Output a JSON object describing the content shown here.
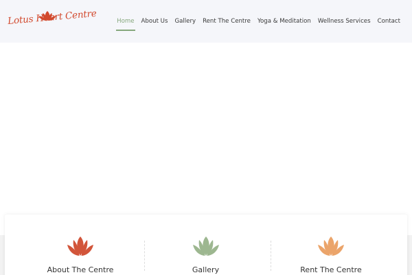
{
  "logo": {
    "text": "Lotus Heart Centre",
    "icon": "lotus-icon",
    "color": "#d24a2e"
  },
  "nav": {
    "items": [
      {
        "label": "Home",
        "active": true
      },
      {
        "label": "About Us"
      },
      {
        "label": "Gallery"
      },
      {
        "label": "Rent The Centre"
      },
      {
        "label": "Yoga & Meditation"
      },
      {
        "label": "Wellness Services"
      },
      {
        "label": "Contact"
      }
    ],
    "active_color": "#85a77c"
  },
  "cards": [
    {
      "title": "About The Centre",
      "icon": "lotus-icon",
      "color": "#d2553a"
    },
    {
      "title": "Gallery",
      "icon": "lotus-icon",
      "color": "#9db790"
    },
    {
      "title": "Rent The Centre",
      "icon": "lotus-icon",
      "color": "#eba46a"
    }
  ]
}
